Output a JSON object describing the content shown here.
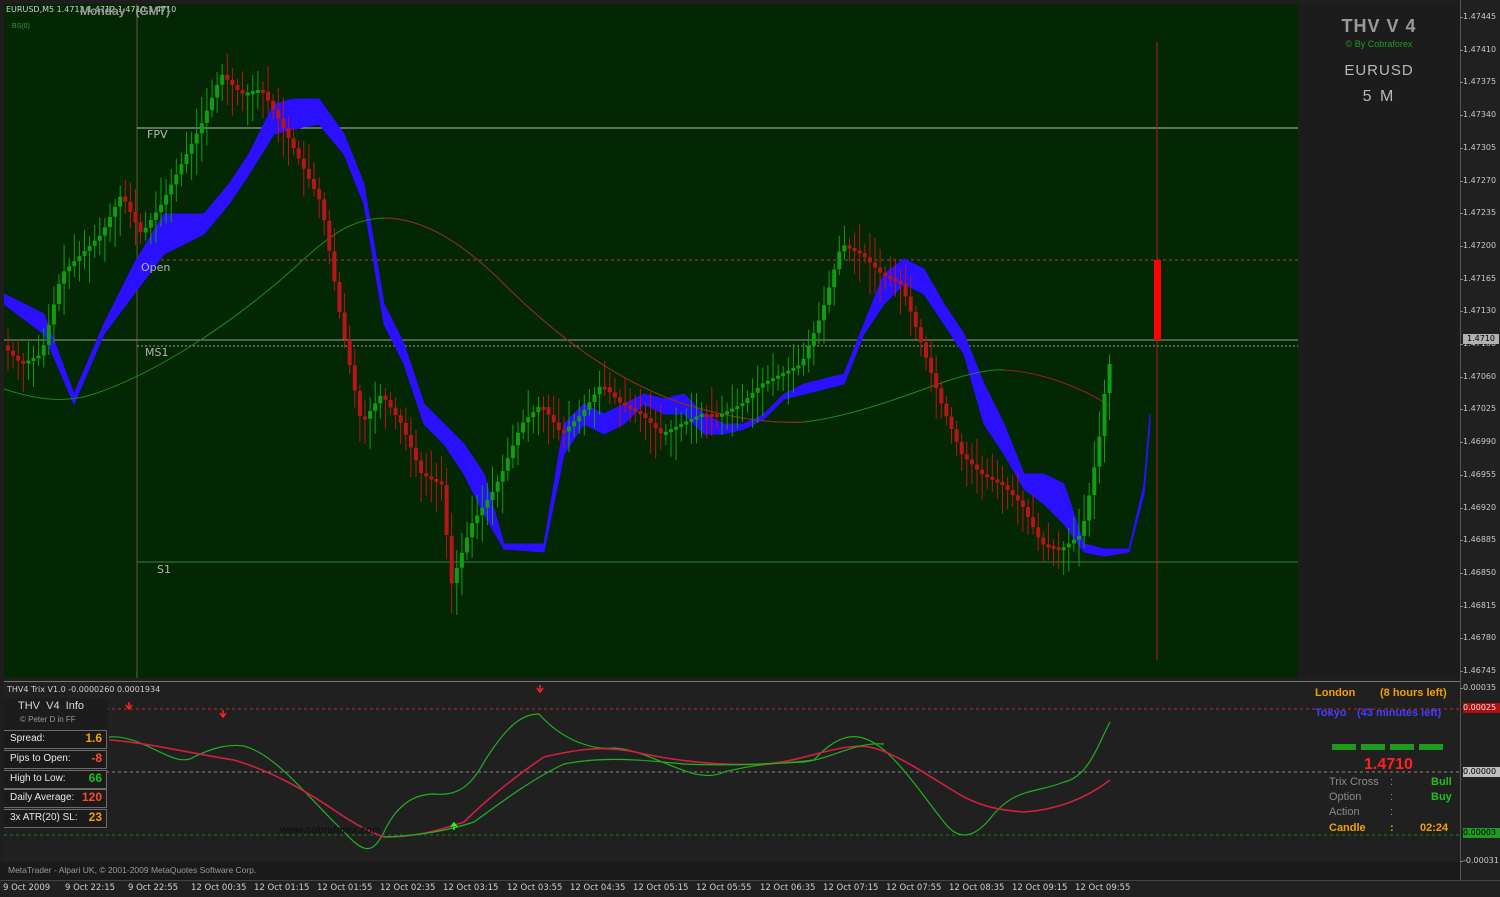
{
  "chart": {
    "symbol_header": "EURUSD,M5  1.4712 1.4712 1.4710 1.4710",
    "day_label": "Monday   (GMT)",
    "indicator_small": "BS(0)",
    "levels": {
      "fpv": "FPV",
      "open": "Open",
      "ms1": "MS1",
      "s1": "S1"
    }
  },
  "side": {
    "title": "THV V 4",
    "byline": "© By Cobraforex",
    "symbol": "EURUSD",
    "timeframe": "5 M"
  },
  "price_scale": [
    "1.47445",
    "1.47410",
    "1.47375",
    "1.47340",
    "1.47305",
    "1.47270",
    "1.47235",
    "1.47200",
    "1.47165",
    "1.47130",
    "1.47100",
    "1.47060",
    "1.47025",
    "1.46990",
    "1.46955",
    "1.46920",
    "1.46885",
    "1.46850",
    "1.46815",
    "1.46780",
    "1.46745"
  ],
  "current_price_tag": "1.4710",
  "sub_scale": {
    "top": "0.00035",
    "upper": "0.00025",
    "zero": "0.00000",
    "lower": "0.00003",
    "bottom": "-0.00031"
  },
  "time_axis": [
    "9 Oct 2009",
    "9 Oct 22:15",
    "9 Oct 22:55",
    "12 Oct 00:35",
    "12 Oct 01:15",
    "12 Oct 01:55",
    "12 Oct 02:35",
    "12 Oct 03:15",
    "12 Oct 03:55",
    "12 Oct 04:35",
    "12 Oct 05:15",
    "12 Oct 05:55",
    "12 Oct 06:35",
    "12 Oct 07:15",
    "12 Oct 07:55",
    "12 Oct 08:35",
    "12 Oct 09:15",
    "12 Oct 09:55"
  ],
  "trix": {
    "header": "THV4 Trix V1.0 -0.0000260 0.0001934",
    "watermark": "www.cobraforex.com"
  },
  "info_panel": {
    "title": "THV  V4  Info",
    "author": "© Peter D in FF",
    "rows": [
      {
        "label": "Spread:",
        "value": "1.6",
        "color": "#f0a000"
      },
      {
        "label": "Pips to Open:",
        "value": "-8",
        "color": "#ff4a2a"
      },
      {
        "label": "High to Low:",
        "value": "66",
        "color": "#1fbf1f"
      },
      {
        "label": "Daily Average:",
        "value": "120",
        "color": "#ff4a2a"
      },
      {
        "label": "3x ATR(20) SL:",
        "value": "23",
        "color": "#f0a000"
      }
    ]
  },
  "sessions": {
    "london_name": "London",
    "london_left": "(8 hours left)",
    "tokyo_name": "Tokyo",
    "tokyo_left": "(43 minutes left)"
  },
  "signals": {
    "price": "1.4710",
    "rows": [
      {
        "label": "Trix Cross",
        "sep": ":",
        "value": "Bull"
      },
      {
        "label": "Option",
        "sep": ":",
        "value": "Buy"
      },
      {
        "label": "Action",
        "sep": ":",
        "value": ""
      },
      {
        "label": "Candle",
        "sep": ":",
        "value": "02:24"
      }
    ]
  },
  "status": {
    "footer": "MetaTrader - Alpari UK, © 2001-2009 MetaQuotes Software Corp."
  },
  "colors": {
    "bull": "#109e10",
    "bear": "#b81616",
    "cloud": "#2b10ff",
    "background": "#032603"
  }
}
